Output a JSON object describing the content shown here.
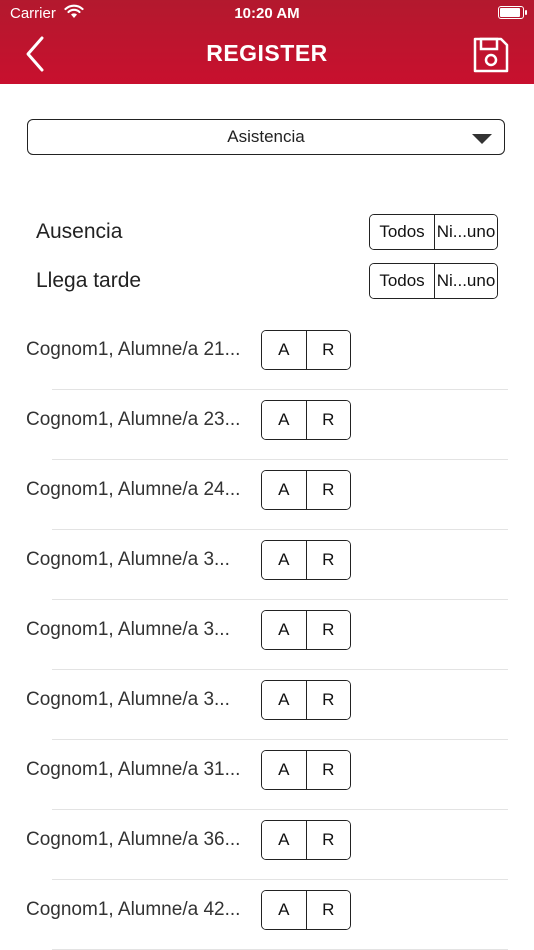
{
  "status_bar": {
    "carrier": "Carrier",
    "time": "10:20 AM"
  },
  "header": {
    "title": "REGISTER",
    "back_icon": "chevron-left-icon",
    "save_icon": "floppy-disk-icon"
  },
  "filter": {
    "selected": "Asistencia"
  },
  "bulk_actions": [
    {
      "label": "Ausencia",
      "all": "Todos",
      "none": "Ni...uno"
    },
    {
      "label": "Llega tarde",
      "all": "Todos",
      "none": "Ni...uno"
    }
  ],
  "students": [
    {
      "name": "Cognom1, Alumne/a 21...",
      "absent": "A",
      "late": "R"
    },
    {
      "name": "Cognom1, Alumne/a 23...",
      "absent": "A",
      "late": "R"
    },
    {
      "name": "Cognom1, Alumne/a 24...",
      "absent": "A",
      "late": "R"
    },
    {
      "name": "Cognom1, Alumne/a 3...",
      "absent": "A",
      "late": "R"
    },
    {
      "name": "Cognom1, Alumne/a 3...",
      "absent": "A",
      "late": "R"
    },
    {
      "name": "Cognom1, Alumne/a 3...",
      "absent": "A",
      "late": "R"
    },
    {
      "name": "Cognom1, Alumne/a 31...",
      "absent": "A",
      "late": "R"
    },
    {
      "name": "Cognom1, Alumne/a 36...",
      "absent": "A",
      "late": "R"
    },
    {
      "name": "Cognom1, Alumne/a 42...",
      "absent": "A",
      "late": "R"
    }
  ],
  "colors": {
    "header": "#c8102e",
    "header_text": "#ffffff",
    "divider": "#e3e3e3"
  }
}
